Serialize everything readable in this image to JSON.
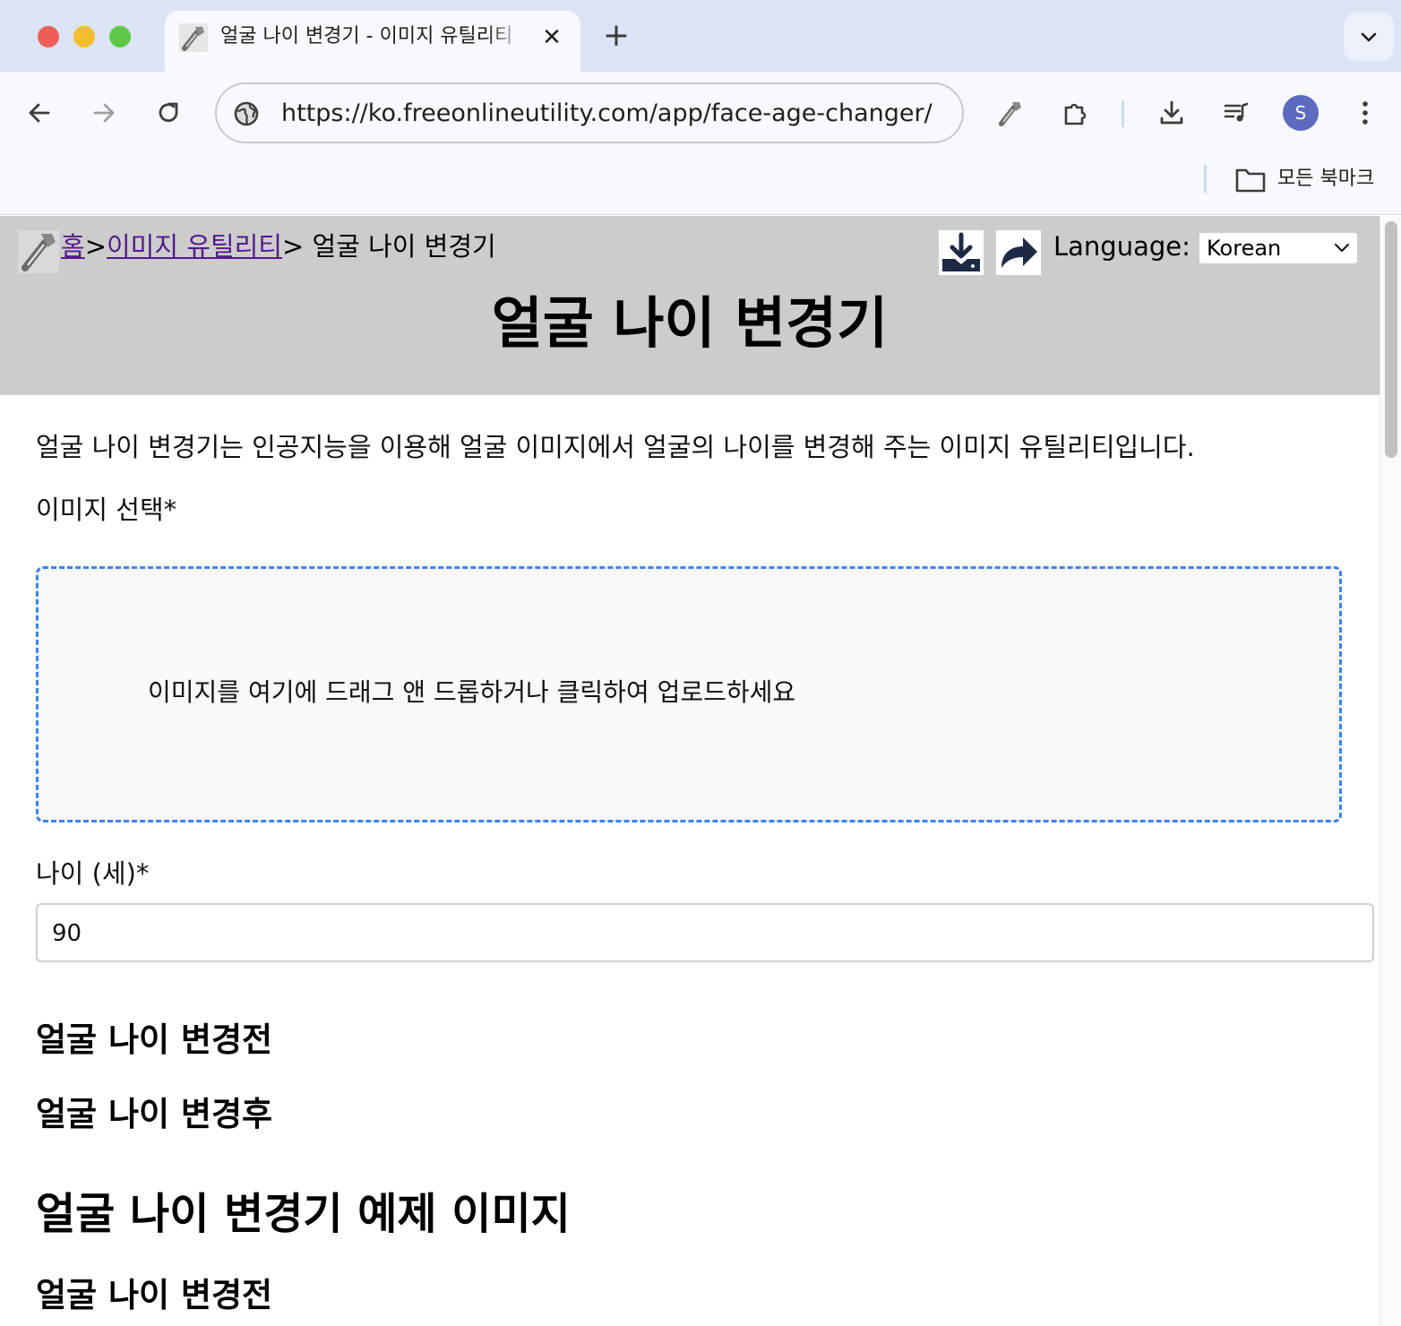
{
  "browser": {
    "tab_title": "얼굴 나이 변경기 - 이미지 유틸리티",
    "tab_close": "✕",
    "new_tab": "+",
    "url": "https://ko.freeonlineutility.com/app/face-age-changer/",
    "avatar_letter": "S",
    "bookmarks_label": "모든 북마크"
  },
  "header": {
    "breadcrumb_home": "홈",
    "breadcrumb_sep": ">",
    "breadcrumb_category": "이미지 유틸리티",
    "breadcrumb_current": "> 얼굴 나이 변경기",
    "language_label": "Language:",
    "language_value": "Korean",
    "title": "얼굴 나이 변경기"
  },
  "main": {
    "intro": "얼굴 나이 변경기는 인공지능을 이용해 얼굴 이미지에서 얼굴의 나이를 변경해 주는 이미지 유틸리티입니다.",
    "image_label": "이미지 선택*",
    "dropzone_text": "이미지를 여기에 드래그 앤 드롭하거나 클릭하여 업로드하세요",
    "age_label": "나이 (세)*",
    "age_value": "90",
    "before_heading": "얼굴 나이 변경전",
    "after_heading": "얼굴 나이 변경후",
    "examples_heading": "얼굴 나이 변경기 예제 이미지",
    "example_before_heading": "얼굴 나이 변경전"
  },
  "colors": {
    "tabbar_bg": "#dbe3f5",
    "toolbar_bg": "#f8f9fe",
    "header_bg": "#cccccc",
    "dropzone_border": "#3b82f6",
    "link_visited": "#551a8b",
    "avatar_bg": "#5c6bc0"
  },
  "icons": [
    "wrench-favicon-icon",
    "close-icon",
    "plus-icon",
    "chevron-down-icon",
    "back-arrow-icon",
    "forward-arrow-icon",
    "reload-icon",
    "site-info-icon",
    "extension-wrench-icon",
    "puzzle-icon",
    "download-icon",
    "media-playlist-icon",
    "kebab-menu-icon",
    "folder-icon",
    "header-download-icon",
    "share-arrow-icon"
  ]
}
